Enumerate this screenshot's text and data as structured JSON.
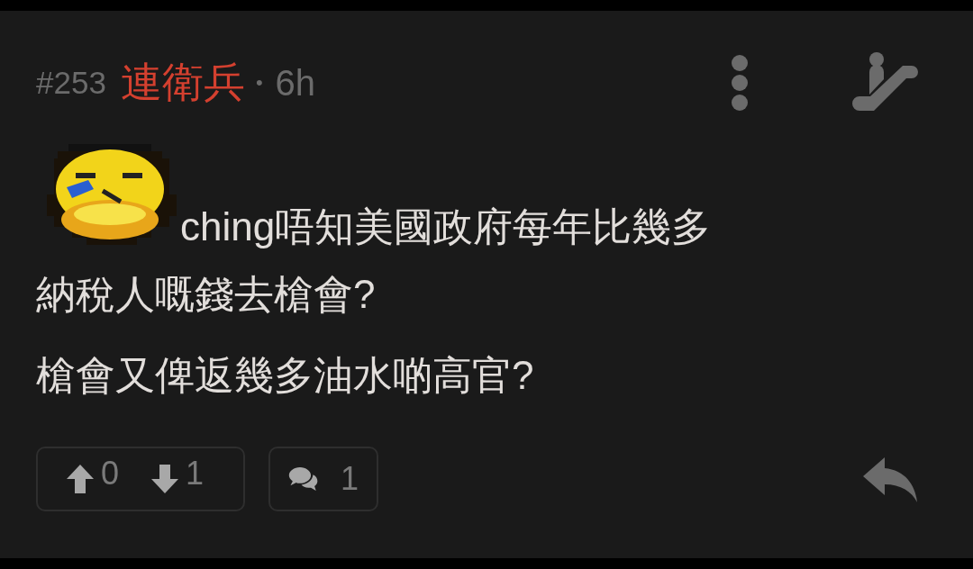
{
  "post": {
    "number": "#253",
    "author": "連衛兵",
    "separator": "•",
    "time": "6h",
    "body_lines": [
      "ching唔知美國政府每年比幾多",
      "納稅人嘅錢去槍會?",
      "槍會又俾返幾多油水啲高官?"
    ]
  },
  "votes": {
    "up": "0",
    "down": "1"
  },
  "comments": {
    "count": "1"
  }
}
